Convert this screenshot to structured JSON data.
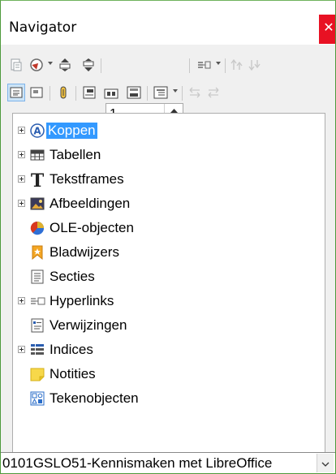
{
  "window": {
    "title": "Navigator",
    "close_glyph": "✕"
  },
  "toolbar": {
    "page_number": "1"
  },
  "tree": {
    "items": [
      {
        "label": "Koppen",
        "icon": "headings-icon",
        "expandable": true,
        "selected": true
      },
      {
        "label": "Tabellen",
        "icon": "table-icon",
        "expandable": true,
        "selected": false
      },
      {
        "label": "Tekstframes",
        "icon": "text-frame-icon",
        "expandable": true,
        "selected": false
      },
      {
        "label": "Afbeeldingen",
        "icon": "image-icon",
        "expandable": true,
        "selected": false
      },
      {
        "label": "OLE-objecten",
        "icon": "ole-object-icon",
        "expandable": false,
        "selected": false
      },
      {
        "label": "Bladwijzers",
        "icon": "bookmark-icon",
        "expandable": false,
        "selected": false
      },
      {
        "label": "Secties",
        "icon": "section-icon",
        "expandable": false,
        "selected": false
      },
      {
        "label": "Hyperlinks",
        "icon": "hyperlink-icon",
        "expandable": true,
        "selected": false
      },
      {
        "label": "Verwijzingen",
        "icon": "reference-icon",
        "expandable": false,
        "selected": false
      },
      {
        "label": "Indices",
        "icon": "index-icon",
        "expandable": true,
        "selected": false
      },
      {
        "label": "Notities",
        "icon": "comment-icon",
        "expandable": false,
        "selected": false
      },
      {
        "label": "Tekenobjecten",
        "icon": "drawing-object-icon",
        "expandable": false,
        "selected": false
      }
    ]
  },
  "document_selector": {
    "value": "0101GSLO51-Kennismaken met LibreOffice"
  },
  "colors": {
    "selection": "#3399ff",
    "close_button": "#e81123",
    "window_border": "#4e9a3c"
  }
}
